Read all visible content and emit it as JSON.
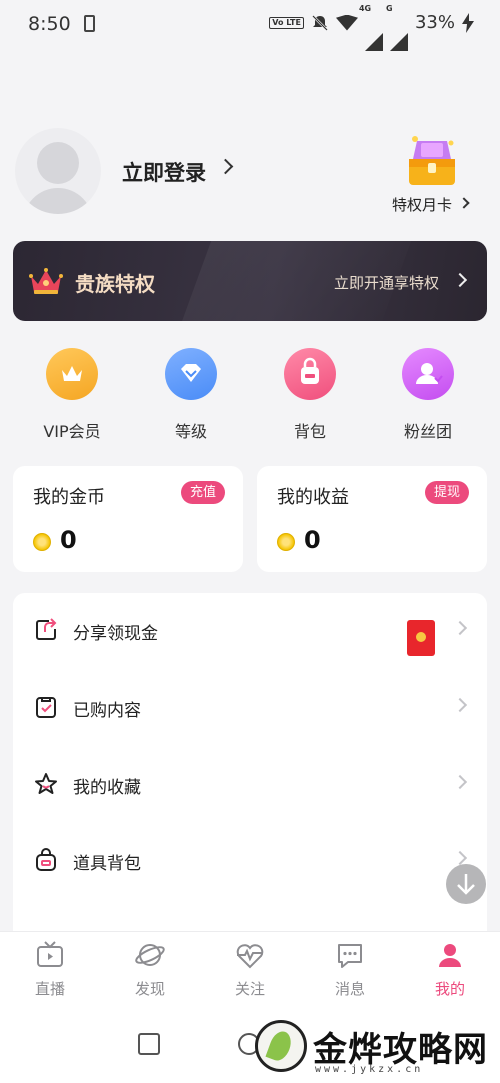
{
  "status_bar": {
    "time": "8:50",
    "volte": "Vo LTE",
    "network": "4G",
    "network2": "G",
    "battery": "33%"
  },
  "profile": {
    "login_label": "立即登录",
    "privilege_card_label": "特权月卡"
  },
  "noble": {
    "title": "贵族特权",
    "action": "立即开通享特权",
    "accent": "#f4dcc3"
  },
  "quick_actions": [
    {
      "label": "VIP会员",
      "icon": "crown-icon",
      "color": "#f5a623"
    },
    {
      "label": "等级",
      "icon": "diamond-icon",
      "color": "#4a8cf7"
    },
    {
      "label": "背包",
      "icon": "backpack-icon",
      "color": "#f04f7d"
    },
    {
      "label": "粉丝团",
      "icon": "fan-group-icon",
      "color": "#c44df0"
    }
  ],
  "wallet": {
    "coins": {
      "title": "我的金币",
      "badge": "充值",
      "amount": "0"
    },
    "earnings": {
      "title": "我的收益",
      "badge": "提现",
      "amount": "0"
    }
  },
  "menu": [
    {
      "label": "分享领现金",
      "icon": "share-icon"
    },
    {
      "label": "已购内容",
      "icon": "purchased-icon"
    },
    {
      "label": "我的收藏",
      "icon": "star-icon"
    },
    {
      "label": "道具背包",
      "icon": "bag-icon"
    }
  ],
  "bottom_nav": [
    {
      "label": "直播",
      "icon": "tv-icon"
    },
    {
      "label": "发现",
      "icon": "planet-icon"
    },
    {
      "label": "关注",
      "icon": "heartbeat-icon"
    },
    {
      "label": "消息",
      "icon": "message-icon"
    },
    {
      "label": "我的",
      "icon": "user-icon",
      "active": true
    }
  ],
  "watermark": {
    "text": "金烨攻略网",
    "url": "www.jykzx.cn"
  },
  "colors": {
    "brand_pink": "#ec4a7d",
    "background": "#f4f4f6"
  }
}
